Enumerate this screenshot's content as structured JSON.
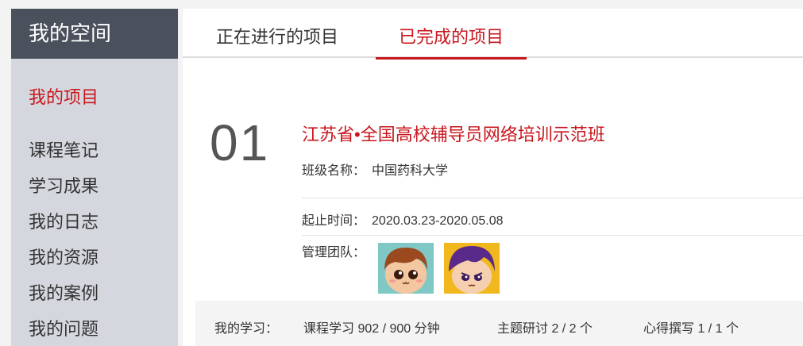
{
  "sidebar": {
    "header": "我的空间",
    "items": [
      {
        "label": "我的项目",
        "active": true
      },
      {
        "label": "课程笔记"
      },
      {
        "label": "学习成果"
      },
      {
        "label": "我的日志"
      },
      {
        "label": "我的资源"
      },
      {
        "label": "我的案例"
      },
      {
        "label": "我的问题"
      }
    ]
  },
  "tabs": [
    {
      "label": "正在进行的项目"
    },
    {
      "label": "已完成的项目",
      "active": true
    }
  ],
  "project": {
    "index": "01",
    "title": "江苏省•全国高校辅导员网络培训示范班",
    "class_label": "班级名称：",
    "class_value": "中国药科大学",
    "period_label": "起止时间：",
    "period_value": "2020.03.23-2020.05.08",
    "team_label": "管理团队："
  },
  "study": {
    "label": "我的学习：",
    "course": "课程学习  902 / 900 分钟",
    "topic": "主题研讨  2 / 2 个",
    "reflect": "心得撰写  1 / 1 个"
  },
  "colors": {
    "accent": "#c8161d",
    "sidebar_header": "#4a505c",
    "sidebar_bg": "#d4d7dd"
  }
}
